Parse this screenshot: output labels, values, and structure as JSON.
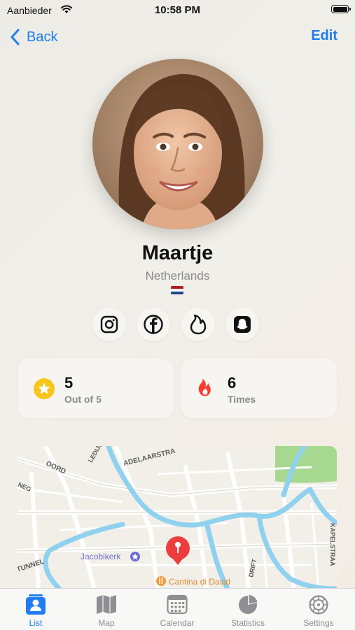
{
  "status_bar": {
    "carrier": "Aanbieder",
    "time": "10:58 PM"
  },
  "nav": {
    "back_label": "Back",
    "edit_label": "Edit"
  },
  "profile": {
    "name": "Maartje",
    "country": "Netherlands",
    "flag_colors": [
      "#ae1c28",
      "#ffffff",
      "#21468b"
    ]
  },
  "social": [
    {
      "name": "instagram-icon"
    },
    {
      "name": "facebook-icon"
    },
    {
      "name": "tinder-icon"
    },
    {
      "name": "snapchat-icon"
    }
  ],
  "stats": {
    "rating": {
      "value": "5",
      "label": "Out of 5",
      "icon": "star-icon",
      "color": "#f6c61a"
    },
    "times": {
      "value": "6",
      "label": "Times",
      "icon": "flame-icon",
      "color": "#ff3b30"
    }
  },
  "map": {
    "labels": {
      "street_1": "ADELAARSTRA",
      "street_2": "OORD",
      "street_3": "LEDIJK",
      "street_4": "NEG",
      "street_5": "KAPELSTRAA",
      "street_6": "TUNNEL",
      "street_7": "DRIFT",
      "poi_church": "Jacobikerk",
      "poi_restaurant": "Cantina di David"
    },
    "colors": {
      "water": "#8fd1ee",
      "park": "#a6d88f",
      "pin": "#ee3d3f",
      "poi": "#6b6bd6"
    }
  },
  "tabs": [
    {
      "label": "List",
      "icon": "list-icon",
      "active": true
    },
    {
      "label": "Map",
      "icon": "map-icon",
      "active": false
    },
    {
      "label": "Calendar",
      "icon": "calendar-icon",
      "active": false
    },
    {
      "label": "Statistics",
      "icon": "statistics-icon",
      "active": false
    },
    {
      "label": "Settings",
      "icon": "settings-icon",
      "active": false
    }
  ],
  "colors": {
    "accent": "#1f7cf2",
    "inactive": "#8e8e93"
  }
}
